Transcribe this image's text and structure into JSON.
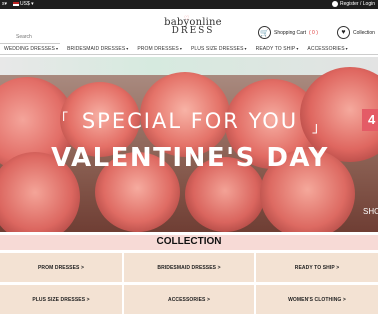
{
  "topbar": {
    "left_a": "s▾",
    "currency": "US$ ▾",
    "account": "Register / Login"
  },
  "search": {
    "placeholder": "Search"
  },
  "logo": {
    "line1": "babyonline",
    "line2": "DRESS"
  },
  "cart": {
    "label": "Shopping Cart",
    "count": "( 0 )"
  },
  "collection_link": "Collection",
  "nav": {
    "items": [
      {
        "label": "WEDDING DRESSES"
      },
      {
        "label": "BRIDESMAID DRESSES"
      },
      {
        "label": "PROM DRESSES"
      },
      {
        "label": "PLUS SIZE DRESSES"
      },
      {
        "label": "READY TO SHIP"
      },
      {
        "label": "ACCESSORIES"
      }
    ]
  },
  "banner": {
    "special": "SPECIAL FOR YOU",
    "vday": "VALENTINE'S DAY",
    "side_number": "4",
    "side_text": "SHO"
  },
  "collection": {
    "title": "COLLECTION",
    "items": [
      {
        "label": "PROM DRESSES >"
      },
      {
        "label": "BRIDESMAID DRESSES >"
      },
      {
        "label": "READY TO SHIP >"
      },
      {
        "label": "PLUS SIZE DRESSES >"
      },
      {
        "label": "ACCESSORIES >"
      },
      {
        "label": "WOMEN'S CLOTHING >"
      }
    ]
  },
  "colors": {
    "topbar": "#1e1e1e",
    "collection_strip": "#f7dad6",
    "category_tile": "#f3e2d3",
    "badge": "#e45b66"
  }
}
